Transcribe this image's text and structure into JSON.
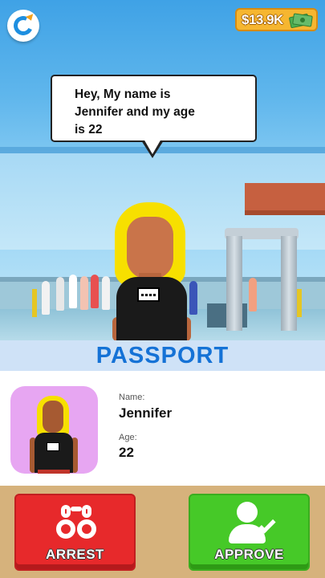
{
  "hud": {
    "restart_icon": "restart-icon",
    "money": "$13.9K",
    "money_icon": "cash-stack-icon"
  },
  "dialogue": {
    "line1": "Hey, My name is",
    "line2": "Jennifer and my age",
    "line3": "is 22"
  },
  "passport": {
    "title": "PASSPORT",
    "name_label": "Name:",
    "name_value": "Jennifer",
    "age_label": "Age:",
    "age_value": "22"
  },
  "actions": {
    "arrest_label": "ARREST",
    "arrest_icon": "handcuffs-icon",
    "arrest_color": "#e7292b",
    "approve_label": "APPROVE",
    "approve_icon": "person-check-icon",
    "approve_color": "#46c928"
  },
  "colors": {
    "passport_title": "#1572d6",
    "money_bg": "#f6b630",
    "action_bg": "#d6b27c"
  }
}
